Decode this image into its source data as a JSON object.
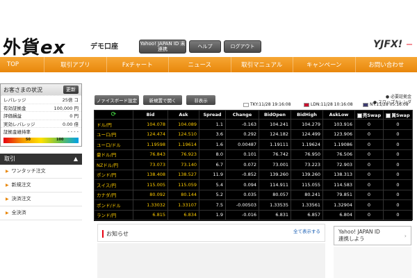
{
  "header": {
    "logo_main": "外貨",
    "logo_ex": "ex",
    "demo_label": "デモ口座",
    "yahoo_button": "Yahoo! JAPAN ID 未連携",
    "help_button": "ヘルプ",
    "logout_button": "ログアウト",
    "brand": "YJFX!",
    "brand_sub": "ー"
  },
  "nav": {
    "items": [
      "TOP",
      "取引アプリ",
      "Fxチャート",
      "ニュース",
      "取引マニュアル",
      "キャンペーン",
      "お問い合わせ"
    ]
  },
  "account": {
    "title": "お客さまの状況",
    "refresh": "更新",
    "rows": [
      {
        "label": "レバレッジ",
        "value": "25倍",
        "unit": "コ"
      },
      {
        "label": "有効証拠金",
        "value": "100,000",
        "unit": "円"
      },
      {
        "label": "評価損益",
        "value": "0",
        "unit": "円"
      },
      {
        "label": "実効レバレッジ",
        "value": "0.00",
        "unit": "倍"
      },
      {
        "label": "証拠金維持率",
        "value": "- - - -",
        "unit": ""
      }
    ],
    "gauge_low": "50",
    "gauge_high": "100"
  },
  "trade_menu": {
    "title": "取引",
    "toggle": "▲",
    "items": [
      "ワンタッチ注文",
      "新規注文",
      "決済注文",
      "全決済"
    ]
  },
  "toolbar": {
    "board_button": "ノァイスボード設定",
    "new_order_button": "新規置で開く",
    "hide_button": "非表示"
  },
  "links": {
    "line1": "必要証拠金",
    "line2": "スワップカレンダ"
  },
  "clocks": {
    "tokyo": "TKY:11/28 19:16:08",
    "london": "LDN:11/28 10:16:08",
    "ny": "NY:11/28 05:16:08"
  },
  "quotes": {
    "headers": [
      "",
      "Bid",
      "Ask",
      "Spread",
      "Change",
      "BidOpen",
      "BidHigh",
      "AskLow",
      "売Swap",
      "買Swap"
    ],
    "rows": [
      {
        "pair": "ドル/円",
        "bid": "104.078",
        "ask": "104.089",
        "spread": "1.1",
        "change": "-0.163",
        "open": "104.241",
        "high": "104.279",
        "low": "103.916",
        "sell": "0",
        "buy": "0"
      },
      {
        "pair": "ユーロ/円",
        "bid": "124.474",
        "ask": "124.510",
        "spread": "3.6",
        "change": "0.292",
        "open": "124.182",
        "high": "124.499",
        "low": "123.906",
        "sell": "0",
        "buy": "0"
      },
      {
        "pair": "ユーロ/ドル",
        "bid": "1.19598",
        "ask": "1.19614",
        "spread": "1.6",
        "change": "0.00487",
        "open": "1.19111",
        "high": "1.19624",
        "low": "1.19086",
        "sell": "0",
        "buy": "0"
      },
      {
        "pair": "豪ドル/円",
        "bid": "76.843",
        "ask": "76.923",
        "spread": "8.0",
        "change": "0.101",
        "open": "76.742",
        "high": "76.950",
        "low": "76.506",
        "sell": "0",
        "buy": "0"
      },
      {
        "pair": "NZドル/円",
        "bid": "73.073",
        "ask": "73.140",
        "spread": "6.7",
        "change": "0.072",
        "open": "73.001",
        "high": "73.223",
        "low": "72.903",
        "sell": "0",
        "buy": "0"
      },
      {
        "pair": "ポンド/円",
        "bid": "138.408",
        "ask": "138.527",
        "spread": "11.9",
        "change": "-0.852",
        "open": "139.260",
        "high": "139.260",
        "low": "138.313",
        "sell": "0",
        "buy": "0"
      },
      {
        "pair": "スイス/円",
        "bid": "115.005",
        "ask": "115.059",
        "spread": "5.4",
        "change": "0.094",
        "open": "114.911",
        "high": "115.055",
        "low": "114.583",
        "sell": "0",
        "buy": "0"
      },
      {
        "pair": "カナダ/円",
        "bid": "80.092",
        "ask": "80.144",
        "spread": "5.2",
        "change": "0.035",
        "open": "80.057",
        "high": "80.241",
        "low": "79.851",
        "sell": "0",
        "buy": "0"
      },
      {
        "pair": "ポンド/ドル",
        "bid": "1.33032",
        "ask": "1.33107",
        "spread": "7.5",
        "change": "-0.00503",
        "open": "1.33535",
        "high": "1.33561",
        "low": "1.32904",
        "sell": "0",
        "buy": "0"
      },
      {
        "pair": "ランド/円",
        "bid": "6.815",
        "ask": "6.834",
        "spread": "1.9",
        "change": "-0.016",
        "open": "6.831",
        "high": "6.857",
        "low": "6.804",
        "sell": "0",
        "buy": "0"
      }
    ]
  },
  "notice": {
    "title": "お知らせ",
    "all_link": "全て表示する"
  },
  "yahoo_box": {
    "line1": "Yahoo! JAPAN ID",
    "line2": "連携しよう",
    "chevron": "›"
  },
  "colors": {
    "nav_orange": "#e8870b",
    "quote_bg": "#000000",
    "quote_text": "#ffcc00",
    "accent_red": "#e60012"
  }
}
